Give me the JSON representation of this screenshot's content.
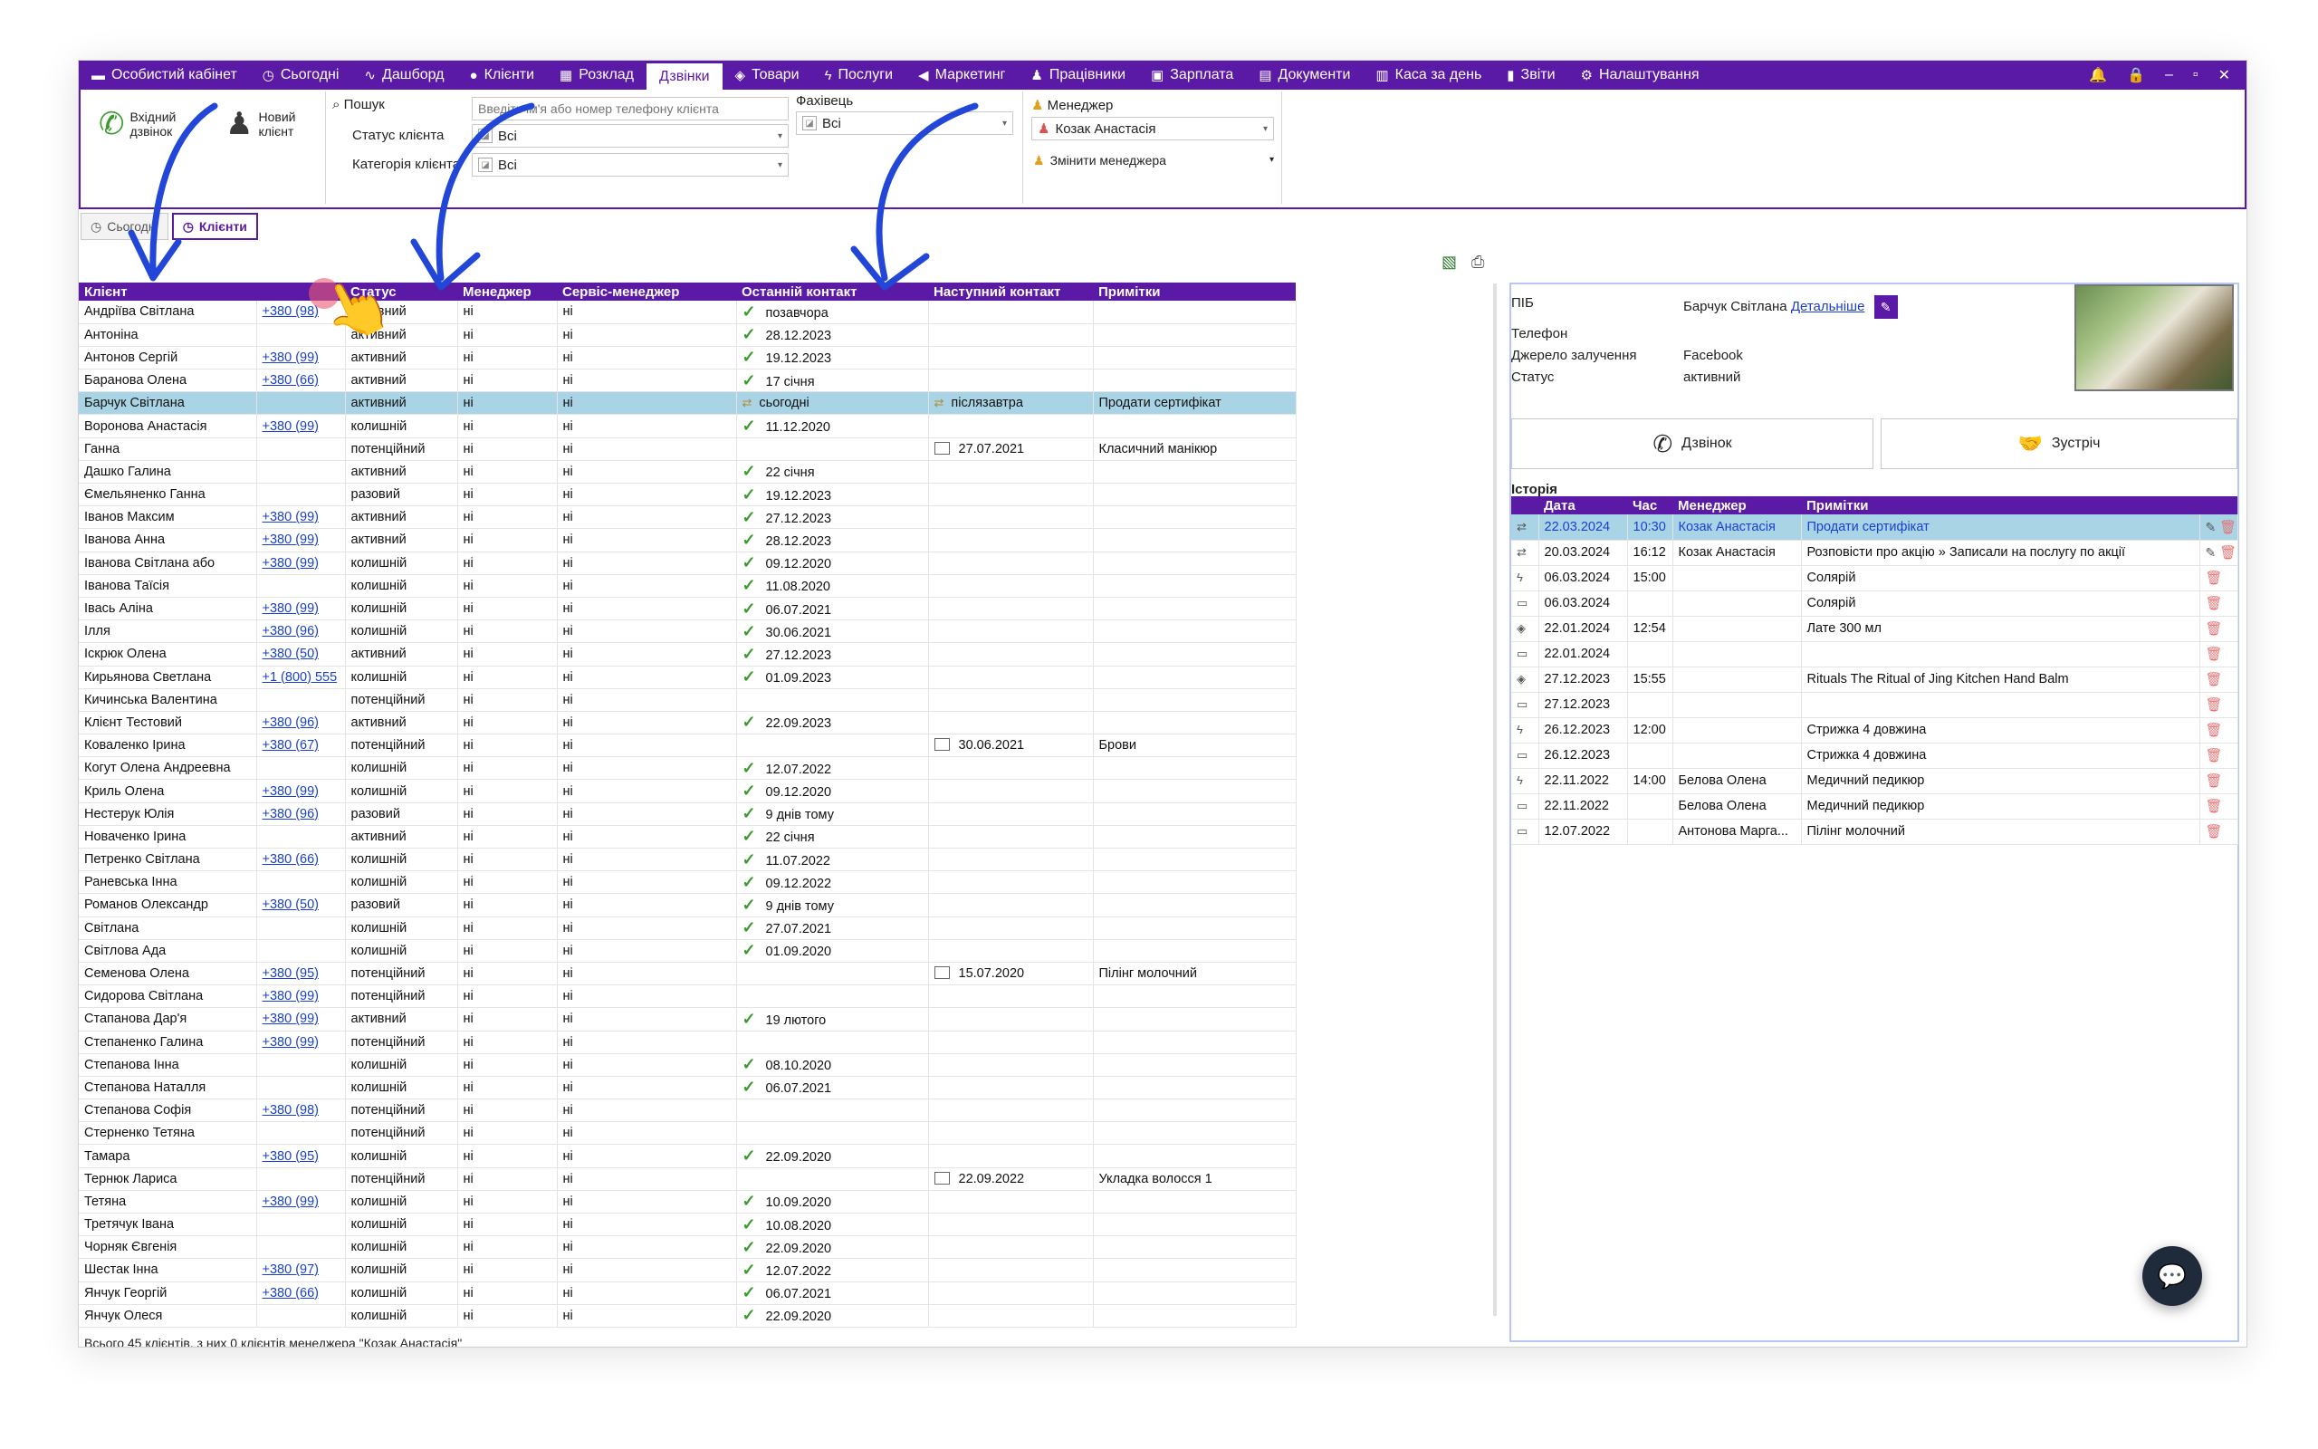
{
  "nav": {
    "items": [
      {
        "icon": "folder-icon",
        "glyph": "▬",
        "label": "Особистий кабінет",
        "active": false
      },
      {
        "icon": "clock-icon",
        "glyph": "◷",
        "label": "Сьогодні",
        "active": false
      },
      {
        "icon": "pulse-icon",
        "glyph": "∿",
        "label": "Дашборд",
        "active": false
      },
      {
        "icon": "user-circle-icon",
        "glyph": "●",
        "label": "Клієнти",
        "active": false
      },
      {
        "icon": "calendar-icon",
        "glyph": "▦",
        "label": "Розклад",
        "active": false
      },
      {
        "icon": "",
        "glyph": "",
        "label": "Дзвінки",
        "active": true
      },
      {
        "icon": "box-icon",
        "glyph": "◈",
        "label": "Товари",
        "active": false
      },
      {
        "icon": "bolt-icon",
        "glyph": "ϟ",
        "label": "Послуги",
        "active": false
      },
      {
        "icon": "megaphone-icon",
        "glyph": "◀",
        "label": "Маркетинг",
        "active": false
      },
      {
        "icon": "person-icon",
        "glyph": "♟",
        "label": "Працівники",
        "active": false
      },
      {
        "icon": "money-icon",
        "glyph": "▣",
        "label": "Зарплата",
        "active": false
      },
      {
        "icon": "document-icon",
        "glyph": "▤",
        "label": "Документи",
        "active": false
      },
      {
        "icon": "calculator-icon",
        "glyph": "▥",
        "label": "Каса за день",
        "active": false
      },
      {
        "icon": "bar-chart-icon",
        "glyph": "▮",
        "label": "Звіти",
        "active": false
      },
      {
        "icon": "gear-icon",
        "glyph": "⚙",
        "label": "Налаштування",
        "active": false
      }
    ],
    "window": {
      "bell": "🔔",
      "lock": "🔒",
      "minimize": "–",
      "restore": "▫",
      "close": "✕"
    }
  },
  "ribbon": {
    "incoming_call": "Вхідний дзвінок",
    "new_client": "Новий клієнт",
    "search_label": "Пошук",
    "search_placeholder": "Введіть ім'я або номер телефону клієнта",
    "status_label": "Статус клієнта",
    "status_value": "Всі",
    "category_label": "Категорія клієнта",
    "category_value": "Всі",
    "specialist_label": "Фахівець",
    "specialist_value": "Всі",
    "manager_label": "Менеджер",
    "manager_value": "Козак Анастасія",
    "change_manager": "Змінити менеджера"
  },
  "subtabs": [
    {
      "label": "Сьогодні",
      "active": false
    },
    {
      "label": "Клієнти",
      "active": true
    }
  ],
  "grid": {
    "headers": [
      "Клієнт",
      "",
      "Статус",
      "Менеджер",
      "Сервіс-менеджер",
      "Останній контакт",
      "Наступний контакт",
      "Примітки"
    ],
    "selected_index": 4,
    "rows": [
      {
        "name": "Андріїва Світлана",
        "phone": "+380 (98)",
        "status": "активний",
        "mgr": "ні",
        "svc": "ні",
        "last_icon": "check",
        "last": "позавчора",
        "next_icon": "",
        "next": "",
        "note": ""
      },
      {
        "name": "Антоніна",
        "phone": "",
        "status": "активний",
        "mgr": "ні",
        "svc": "ні",
        "last_icon": "check",
        "last": "28.12.2023",
        "next_icon": "",
        "next": "",
        "note": ""
      },
      {
        "name": "Антонов Сергій",
        "phone": "+380 (99)",
        "status": "активний",
        "mgr": "ні",
        "svc": "ні",
        "last_icon": "check",
        "last": "19.12.2023",
        "next_icon": "",
        "next": "",
        "note": ""
      },
      {
        "name": "Баранова Олена",
        "phone": "+380 (66)",
        "status": "активний",
        "mgr": "ні",
        "svc": "ні",
        "last_icon": "check",
        "last": "17 січня",
        "next_icon": "",
        "next": "",
        "note": ""
      },
      {
        "name": "Барчук Світлана",
        "phone": "",
        "status": "активний",
        "mgr": "ні",
        "svc": "ні",
        "last_icon": "handshake",
        "last": "сьогодні",
        "next_icon": "handshake",
        "next": "післязавтра",
        "note": "Продати сертифікат"
      },
      {
        "name": "Воронова Анастасія",
        "phone": "+380 (99)",
        "status": "колишній",
        "mgr": "ні",
        "svc": "ні",
        "last_icon": "check",
        "last": "11.12.2020",
        "next_icon": "",
        "next": "",
        "note": ""
      },
      {
        "name": "Ганна",
        "phone": "",
        "status": "потенційний",
        "mgr": "ні",
        "svc": "ні",
        "last_icon": "",
        "last": "",
        "next_icon": "calendar",
        "next": "27.07.2021",
        "note": "Класичний манікюр"
      },
      {
        "name": "Дашко Галина",
        "phone": "",
        "status": "активний",
        "mgr": "ні",
        "svc": "ні",
        "last_icon": "check",
        "last": "22 січня",
        "next_icon": "",
        "next": "",
        "note": ""
      },
      {
        "name": "Ємельяненко Ганна",
        "phone": "",
        "status": "разовий",
        "mgr": "ні",
        "svc": "ні",
        "last_icon": "check",
        "last": "19.12.2023",
        "next_icon": "",
        "next": "",
        "note": ""
      },
      {
        "name": "Іванов Максим",
        "phone": "+380 (99)",
        "status": "активний",
        "mgr": "ні",
        "svc": "ні",
        "last_icon": "check",
        "last": "27.12.2023",
        "next_icon": "",
        "next": "",
        "note": ""
      },
      {
        "name": "Іванова Анна",
        "phone": "+380 (99)",
        "status": "активний",
        "mgr": "ні",
        "svc": "ні",
        "last_icon": "check",
        "last": "28.12.2023",
        "next_icon": "",
        "next": "",
        "note": ""
      },
      {
        "name": "Іванова Світлана або",
        "phone": "+380 (99)",
        "status": "колишній",
        "mgr": "ні",
        "svc": "ні",
        "last_icon": "check",
        "last": "09.12.2020",
        "next_icon": "",
        "next": "",
        "note": ""
      },
      {
        "name": "Іванова Таїсія",
        "phone": "",
        "status": "колишній",
        "mgr": "ні",
        "svc": "ні",
        "last_icon": "check",
        "last": "11.08.2020",
        "next_icon": "",
        "next": "",
        "note": ""
      },
      {
        "name": "Івась Аліна",
        "phone": "+380 (99)",
        "status": "колишній",
        "mgr": "ні",
        "svc": "ні",
        "last_icon": "check",
        "last": "06.07.2021",
        "next_icon": "",
        "next": "",
        "note": ""
      },
      {
        "name": "Ілля",
        "phone": "+380 (96)",
        "status": "колишній",
        "mgr": "ні",
        "svc": "ні",
        "last_icon": "check",
        "last": "30.06.2021",
        "next_icon": "",
        "next": "",
        "note": ""
      },
      {
        "name": "Іскрюк Олена",
        "phone": "+380 (50)",
        "status": "активний",
        "mgr": "ні",
        "svc": "ні",
        "last_icon": "check",
        "last": "27.12.2023",
        "next_icon": "",
        "next": "",
        "note": ""
      },
      {
        "name": "Кирьянова Светлана",
        "phone": "+1 (800) 555",
        "status": "колишній",
        "mgr": "ні",
        "svc": "ні",
        "last_icon": "check",
        "last": "01.09.2023",
        "next_icon": "",
        "next": "",
        "note": ""
      },
      {
        "name": "Кичинська Валентина",
        "phone": "",
        "status": "потенційний",
        "mgr": "ні",
        "svc": "ні",
        "last_icon": "",
        "last": "",
        "next_icon": "",
        "next": "",
        "note": ""
      },
      {
        "name": "Клієнт Тестовий",
        "phone": "+380 (96)",
        "status": "активний",
        "mgr": "ні",
        "svc": "ні",
        "last_icon": "check",
        "last": "22.09.2023",
        "next_icon": "",
        "next": "",
        "note": ""
      },
      {
        "name": "Коваленко Ірина",
        "phone": "+380 (67)",
        "status": "потенційний",
        "mgr": "ні",
        "svc": "ні",
        "last_icon": "",
        "last": "",
        "next_icon": "calendar",
        "next": "30.06.2021",
        "note": "Брови"
      },
      {
        "name": "Когут Олена Андреевна",
        "phone": "",
        "status": "колишній",
        "mgr": "ні",
        "svc": "ні",
        "last_icon": "check",
        "last": "12.07.2022",
        "next_icon": "",
        "next": "",
        "note": ""
      },
      {
        "name": "Криль Олена",
        "phone": "+380 (99)",
        "status": "колишній",
        "mgr": "ні",
        "svc": "ні",
        "last_icon": "check",
        "last": "09.12.2020",
        "next_icon": "",
        "next": "",
        "note": ""
      },
      {
        "name": "Нестерук Юлія",
        "phone": "+380 (96)",
        "status": "разовий",
        "mgr": "ні",
        "svc": "ні",
        "last_icon": "check",
        "last": "9 днів тому",
        "next_icon": "",
        "next": "",
        "note": ""
      },
      {
        "name": "Новаченко Ірина",
        "phone": "",
        "status": "активний",
        "mgr": "ні",
        "svc": "ні",
        "last_icon": "check",
        "last": "22 січня",
        "next_icon": "",
        "next": "",
        "note": ""
      },
      {
        "name": "Петренко Світлана",
        "phone": "+380 (66)",
        "status": "колишній",
        "mgr": "ні",
        "svc": "ні",
        "last_icon": "check",
        "last": "11.07.2022",
        "next_icon": "",
        "next": "",
        "note": ""
      },
      {
        "name": "Раневська Інна",
        "phone": "",
        "status": "колишній",
        "mgr": "ні",
        "svc": "ні",
        "last_icon": "check",
        "last": "09.12.2022",
        "next_icon": "",
        "next": "",
        "note": ""
      },
      {
        "name": "Романов Олександр",
        "phone": "+380 (50)",
        "status": "разовий",
        "mgr": "ні",
        "svc": "ні",
        "last_icon": "check",
        "last": "9 днів тому",
        "next_icon": "",
        "next": "",
        "note": ""
      },
      {
        "name": "Світлана",
        "phone": "",
        "status": "колишній",
        "mgr": "ні",
        "svc": "ні",
        "last_icon": "check",
        "last": "27.07.2021",
        "next_icon": "",
        "next": "",
        "note": ""
      },
      {
        "name": "Світлова Ада",
        "phone": "",
        "status": "колишній",
        "mgr": "ні",
        "svc": "ні",
        "last_icon": "check",
        "last": "01.09.2020",
        "next_icon": "",
        "next": "",
        "note": ""
      },
      {
        "name": "Семенова Олена",
        "phone": "+380 (95)",
        "status": "потенційний",
        "mgr": "ні",
        "svc": "ні",
        "last_icon": "",
        "last": "",
        "next_icon": "calendar",
        "next": "15.07.2020",
        "note": "Пілінг молочний"
      },
      {
        "name": "Сидорова Світлана",
        "phone": "+380 (99)",
        "status": "потенційний",
        "mgr": "ні",
        "svc": "ні",
        "last_icon": "",
        "last": "",
        "next_icon": "",
        "next": "",
        "note": ""
      },
      {
        "name": "Стапанова Дар'я",
        "phone": "+380 (99)",
        "status": "активний",
        "mgr": "ні",
        "svc": "ні",
        "last_icon": "check",
        "last": "19 лютого",
        "next_icon": "",
        "next": "",
        "note": ""
      },
      {
        "name": "Степаненко Галина",
        "phone": "+380 (99)",
        "status": "потенційний",
        "mgr": "ні",
        "svc": "ні",
        "last_icon": "",
        "last": "",
        "next_icon": "",
        "next": "",
        "note": ""
      },
      {
        "name": "Степанова Інна",
        "phone": "",
        "status": "колишній",
        "mgr": "ні",
        "svc": "ні",
        "last_icon": "check",
        "last": "08.10.2020",
        "next_icon": "",
        "next": "",
        "note": ""
      },
      {
        "name": "Степанова Наталля",
        "phone": "",
        "status": "колишній",
        "mgr": "ні",
        "svc": "ні",
        "last_icon": "check",
        "last": "06.07.2021",
        "next_icon": "",
        "next": "",
        "note": ""
      },
      {
        "name": "Степанова Софія",
        "phone": "+380 (98)",
        "status": "потенційний",
        "mgr": "ні",
        "svc": "ні",
        "last_icon": "",
        "last": "",
        "next_icon": "",
        "next": "",
        "note": ""
      },
      {
        "name": "Стерненко Тетяна",
        "phone": "",
        "status": "потенційний",
        "mgr": "ні",
        "svc": "ні",
        "last_icon": "",
        "last": "",
        "next_icon": "",
        "next": "",
        "note": ""
      },
      {
        "name": "Тамара",
        "phone": "+380 (95)",
        "status": "колишній",
        "mgr": "ні",
        "svc": "ні",
        "last_icon": "check",
        "last": "22.09.2020",
        "next_icon": "",
        "next": "",
        "note": ""
      },
      {
        "name": "Тернюк Лариса",
        "phone": "",
        "status": "потенційний",
        "mgr": "ні",
        "svc": "ні",
        "last_icon": "",
        "last": "",
        "next_icon": "calendar",
        "next": "22.09.2022",
        "note": "Укладка волосся 1"
      },
      {
        "name": "Тетяна",
        "phone": "+380 (99)",
        "status": "колишній",
        "mgr": "ні",
        "svc": "ні",
        "last_icon": "check",
        "last": "10.09.2020",
        "next_icon": "",
        "next": "",
        "note": ""
      },
      {
        "name": "Третячук Івана",
        "phone": "",
        "status": "колишній",
        "mgr": "ні",
        "svc": "ні",
        "last_icon": "check",
        "last": "10.08.2020",
        "next_icon": "",
        "next": "",
        "note": ""
      },
      {
        "name": "Чорняк Євгенія",
        "phone": "",
        "status": "колишній",
        "mgr": "ні",
        "svc": "ні",
        "last_icon": "check",
        "last": "22.09.2020",
        "next_icon": "",
        "next": "",
        "note": ""
      },
      {
        "name": "Шестак Інна",
        "phone": "+380 (97)",
        "status": "колишній",
        "mgr": "ні",
        "svc": "ні",
        "last_icon": "check",
        "last": "12.07.2022",
        "next_icon": "",
        "next": "",
        "note": ""
      },
      {
        "name": "Янчук Георгій",
        "phone": "+380 (66)",
        "status": "колишній",
        "mgr": "ні",
        "svc": "ні",
        "last_icon": "check",
        "last": "06.07.2021",
        "next_icon": "",
        "next": "",
        "note": ""
      },
      {
        "name": "Янчук Олеся",
        "phone": "",
        "status": "колишній",
        "mgr": "ні",
        "svc": "ні",
        "last_icon": "check",
        "last": "22.09.2020",
        "next_icon": "",
        "next": "",
        "note": ""
      }
    ]
  },
  "footer": "Всього 45 клієнтів, з них 0 клієнтів менеджера \"Козак Анастасія\"",
  "detail": {
    "pib_label": "ПІБ",
    "pib_value": "Барчук Світлана",
    "more_link": "Детальніше",
    "phone_label": "Телефон",
    "source_label": "Джерело залучення",
    "source_value": "Facebook",
    "status_label": "Статус",
    "status_value": "активний",
    "call_button": "Дзвінок",
    "meeting_button": "Зустріч",
    "history_title": "Історія",
    "history_headers": [
      "",
      "Дата",
      "Час",
      "Менеджер",
      "Примітки",
      ""
    ],
    "history": [
      {
        "icon": "handshake",
        "date": "22.03.2024",
        "time": "10:30",
        "manager": "Козак Анастасія",
        "note": "Продати сертифікат",
        "edit": true
      },
      {
        "icon": "handshake",
        "date": "20.03.2024",
        "time": "16:12",
        "manager": "Козак Анастасія",
        "note": "Розповісти про акцію » Записали на послугу по акції",
        "edit": true
      },
      {
        "icon": "bolt",
        "date": "06.03.2024",
        "time": "15:00",
        "manager": "",
        "note": "Солярій",
        "edit": false
      },
      {
        "icon": "calendar",
        "date": "06.03.2024",
        "time": "",
        "manager": "",
        "note": "Солярій",
        "edit": false
      },
      {
        "icon": "box",
        "date": "22.01.2024",
        "time": "12:54",
        "manager": "",
        "note": "Лате 300 мл",
        "edit": false
      },
      {
        "icon": "calendar",
        "date": "22.01.2024",
        "time": "",
        "manager": "",
        "note": "",
        "edit": false
      },
      {
        "icon": "box",
        "date": "27.12.2023",
        "time": "15:55",
        "manager": "",
        "note": "Rituals The Ritual of Jing Kitchen Hand Balm",
        "edit": false
      },
      {
        "icon": "calendar",
        "date": "27.12.2023",
        "time": "",
        "manager": "",
        "note": "",
        "edit": false
      },
      {
        "icon": "bolt",
        "date": "26.12.2023",
        "time": "12:00",
        "manager": "",
        "note": "Стрижка 4 довжина",
        "edit": false
      },
      {
        "icon": "calendar",
        "date": "26.12.2023",
        "time": "",
        "manager": "",
        "note": "Стрижка 4 довжина",
        "edit": false
      },
      {
        "icon": "bolt",
        "date": "22.11.2022",
        "time": "14:00",
        "manager": "Белова Олена",
        "note": "Медичний педикюр",
        "edit": false
      },
      {
        "icon": "calendar",
        "date": "22.11.2022",
        "time": "",
        "manager": "Белова Олена",
        "note": "Медичний педикюр",
        "edit": false
      },
      {
        "icon": "calendar",
        "date": "12.07.2022",
        "time": "",
        "manager": "Антонова Марга...",
        "note": "Пілінг молочний",
        "edit": false
      }
    ]
  },
  "colors": {
    "brand": "#5b1aa6",
    "selected_row": "#a9d4e6",
    "link": "#1a3fd0",
    "check": "#3a9a2e",
    "arrow": "#2146d8"
  }
}
